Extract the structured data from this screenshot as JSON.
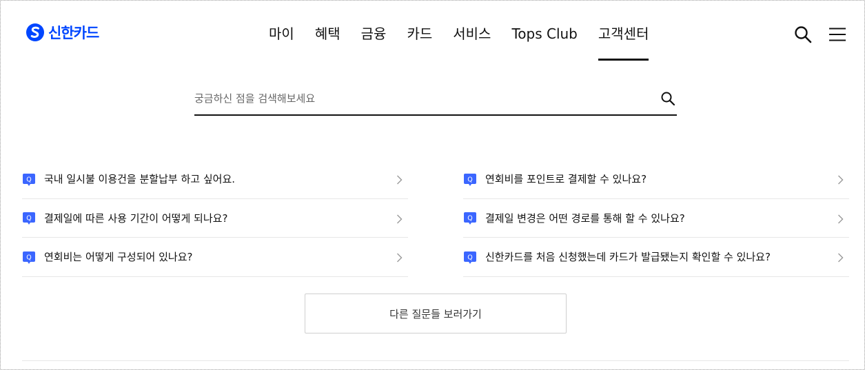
{
  "header": {
    "logo_text": "신한카드",
    "nav": [
      {
        "label": "마이"
      },
      {
        "label": "혜택"
      },
      {
        "label": "금융"
      },
      {
        "label": "카드"
      },
      {
        "label": "서비스"
      },
      {
        "label": "Tops Club"
      },
      {
        "label": "고객센터",
        "active": true
      }
    ],
    "icons": [
      "search-icon",
      "hamburger-menu-icon"
    ]
  },
  "search": {
    "placeholder": "궁금하신 점을 검색해보세요",
    "value": ""
  },
  "faq": {
    "badge": "Q",
    "left": [
      {
        "question": "국내 일시불 이용건을 분할납부 하고 싶어요."
      },
      {
        "question": "결제일에 따른 사용 기간이 어떻게 되나요?"
      },
      {
        "question": "연회비는 어떻게 구성되어 있나요?"
      }
    ],
    "right": [
      {
        "question": "연회비를 포인트로 결제할 수 있나요?"
      },
      {
        "question": "결제일 변경은 어떤 경로를 통해 할 수 있나요?"
      },
      {
        "question": "신한카드를 처음 신청했는데 카드가 발급됐는지 확인할 수 있나요?"
      }
    ]
  },
  "more_button_label": "다른 질문들 보러가기",
  "colors": {
    "brand_blue": "#0046ff",
    "badge_blue": "#3b66ff",
    "text": "#111111",
    "divider": "#e7e7e7"
  }
}
